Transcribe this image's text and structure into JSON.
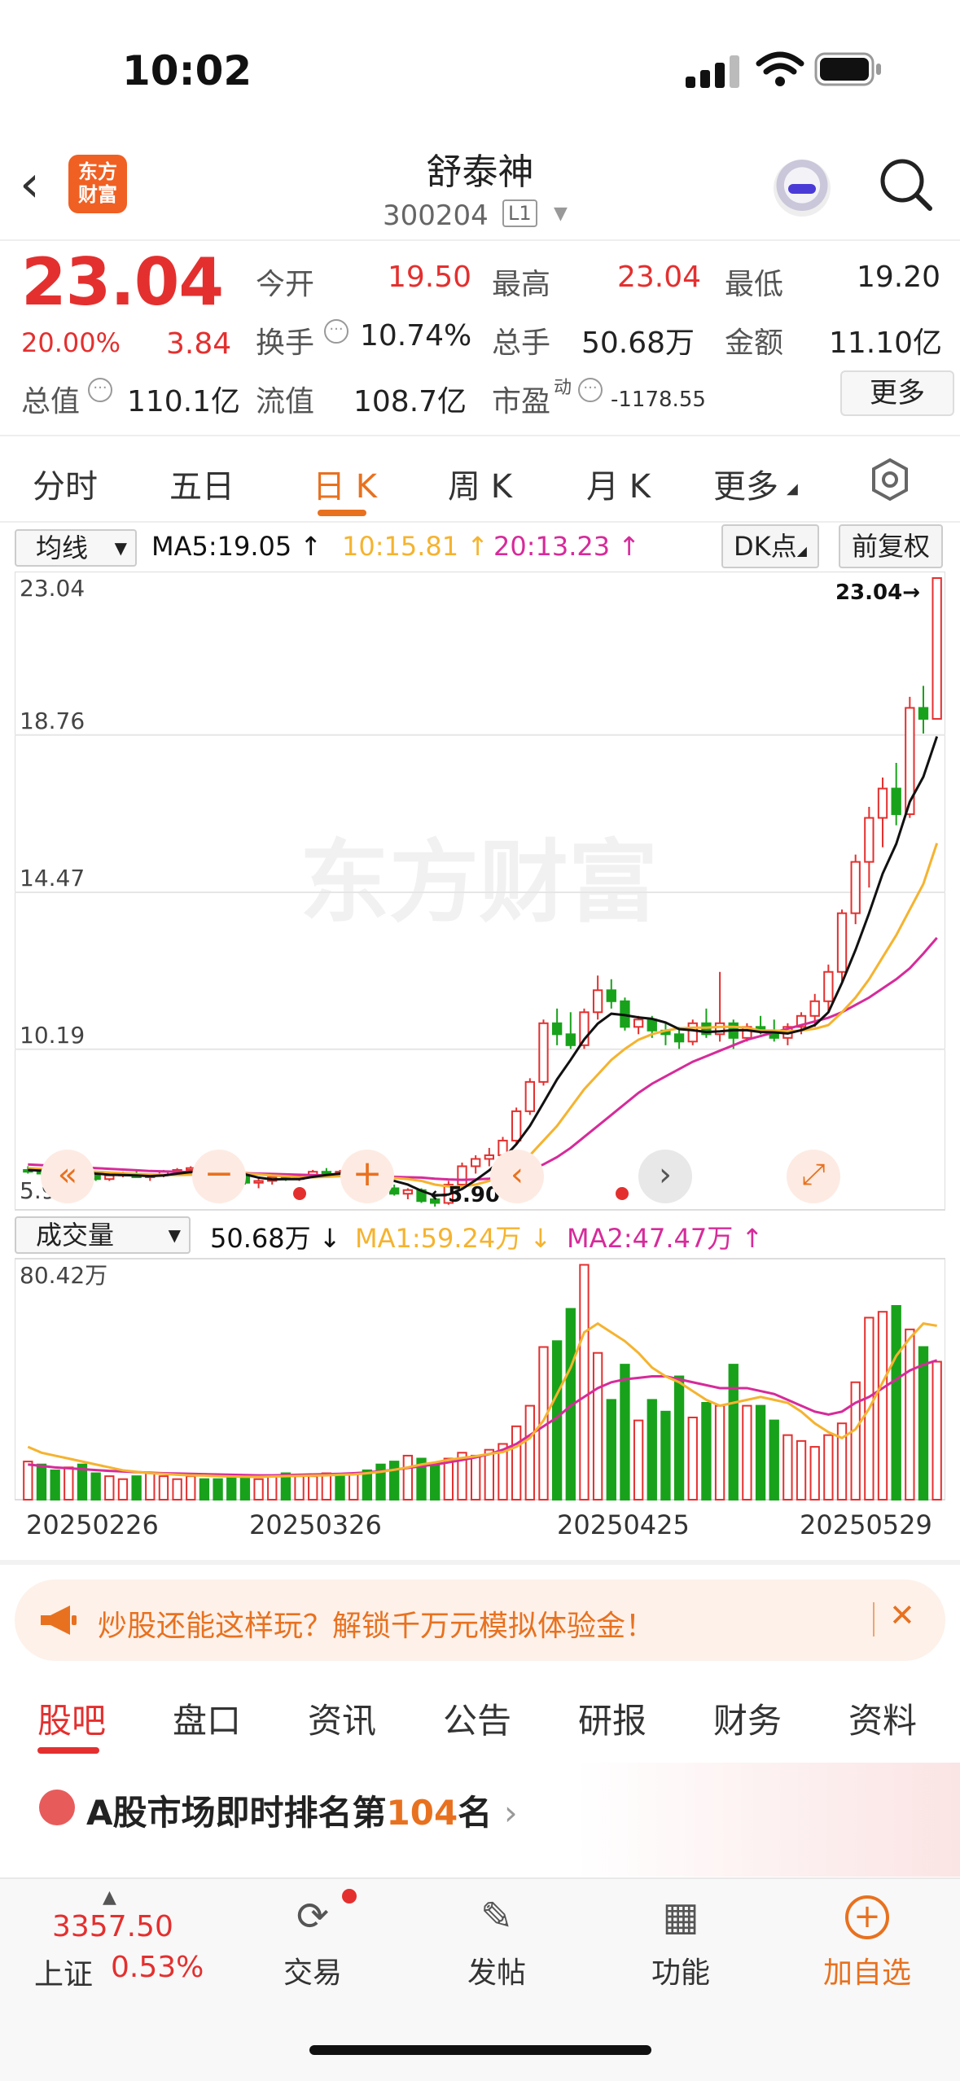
{
  "status_bar": {
    "time": "10:02"
  },
  "header": {
    "back_icon": "chevron-left-icon",
    "logo_line1": "东方",
    "logo_line2": "财富",
    "stock_name": "舒泰神",
    "stock_code": "300204",
    "level_badge": "L1",
    "search_icon": "search-icon"
  },
  "quote": {
    "price": "23.04",
    "change_pct": "20.00%",
    "change_amt": "3.84",
    "open_label": "今开",
    "open_value": "19.50",
    "high_label": "最高",
    "high_value": "23.04",
    "low_label": "最低",
    "low_value": "19.20",
    "turnover_label": "换手",
    "turnover_value": "10.74%",
    "volume_label": "总手",
    "volume_value": "50.68万",
    "amount_label": "金额",
    "amount_value": "11.10亿",
    "mktcap_label": "总值",
    "mktcap_value": "110.1亿",
    "float_label": "流值",
    "float_value": "108.7亿",
    "pe_label": "市盈",
    "pe_sup": "动",
    "pe_value": "-1178.55",
    "more_label": "更多"
  },
  "period_tabs": [
    "分时",
    "五日",
    "日 K",
    "周 K",
    "月 K",
    "更多"
  ],
  "active_period": "日 K",
  "kline_toolbar": {
    "indicator_select": "均线",
    "ma5": "MA5:19.05",
    "ma10": "10:15.81",
    "ma20": "20:13.23",
    "dk_label": "DK点",
    "adjust_label": "前复权"
  },
  "price_axis": [
    "23.04",
    "18.76",
    "14.47",
    "10.19",
    "5.90"
  ],
  "max_marker": "23.04→",
  "min_marker": "←5.90",
  "watermark": "东方财富",
  "volume_toolbar": {
    "indicator_select": "成交量",
    "volume": "50.68万",
    "ma1": "MA1:59.24万",
    "ma2": "MA2:47.47万"
  },
  "volume_axis_top": "80.42万",
  "date_axis": [
    "20250226",
    "20250326",
    "20250425",
    "20250529"
  ],
  "colors": {
    "up": "#e3302f",
    "down": "#18a21b",
    "ma5": "#111111",
    "ma10": "#f5b32f",
    "ma20": "#d62b9a",
    "accent": "#e8711f"
  },
  "chart_data": {
    "type": "candlestick",
    "ylim": [
      5.9,
      23.04
    ],
    "candles": [
      [
        6.9,
        7.0,
        6.8,
        6.85
      ],
      [
        6.85,
        6.95,
        6.75,
        6.8
      ],
      [
        6.8,
        6.9,
        6.7,
        6.9
      ],
      [
        6.9,
        6.95,
        6.8,
        6.85
      ],
      [
        6.85,
        6.9,
        6.75,
        6.8
      ],
      [
        6.8,
        6.85,
        6.6,
        6.65
      ],
      [
        6.65,
        6.8,
        6.6,
        6.75
      ],
      [
        6.75,
        6.85,
        6.7,
        6.8
      ],
      [
        6.8,
        6.9,
        6.7,
        6.7
      ],
      [
        6.7,
        6.8,
        6.6,
        6.75
      ],
      [
        6.75,
        6.9,
        6.7,
        6.85
      ],
      [
        6.85,
        6.95,
        6.8,
        6.9
      ],
      [
        6.9,
        7.0,
        6.8,
        6.95
      ],
      [
        6.95,
        7.0,
        6.85,
        6.9
      ],
      [
        6.9,
        6.95,
        6.8,
        6.85
      ],
      [
        6.85,
        6.9,
        6.7,
        6.75
      ],
      [
        6.75,
        6.8,
        6.5,
        6.55
      ],
      [
        6.55,
        6.7,
        6.4,
        6.6
      ],
      [
        6.6,
        6.75,
        6.5,
        6.7
      ],
      [
        6.7,
        6.8,
        6.6,
        6.65
      ],
      [
        6.65,
        6.8,
        6.6,
        6.75
      ],
      [
        6.75,
        6.9,
        6.7,
        6.85
      ],
      [
        6.85,
        6.95,
        6.7,
        6.8
      ],
      [
        6.8,
        6.9,
        6.7,
        6.85
      ],
      [
        6.85,
        7.0,
        6.8,
        6.95
      ],
      [
        6.95,
        7.0,
        6.6,
        6.65
      ],
      [
        6.65,
        6.7,
        6.3,
        6.35
      ],
      [
        6.4,
        6.5,
        6.2,
        6.25
      ],
      [
        6.25,
        6.4,
        6.1,
        6.35
      ],
      [
        6.35,
        6.4,
        6.0,
        6.05
      ],
      [
        6.1,
        6.2,
        5.9,
        6.0
      ],
      [
        6.0,
        6.6,
        5.95,
        6.5
      ],
      [
        6.5,
        7.1,
        6.4,
        7.0
      ],
      [
        7.0,
        7.3,
        6.8,
        7.2
      ],
      [
        7.2,
        7.5,
        7.0,
        7.3
      ],
      [
        7.3,
        7.8,
        7.2,
        7.7
      ],
      [
        7.7,
        8.6,
        7.6,
        8.5
      ],
      [
        8.5,
        9.4,
        8.4,
        9.3
      ],
      [
        9.3,
        11.0,
        9.2,
        10.9
      ],
      [
        10.9,
        11.3,
        10.3,
        10.6
      ],
      [
        10.6,
        11.2,
        10.2,
        10.3
      ],
      [
        10.3,
        11.3,
        10.2,
        11.2
      ],
      [
        11.2,
        12.2,
        11.0,
        11.8
      ],
      [
        11.8,
        12.1,
        11.3,
        11.5
      ],
      [
        11.5,
        11.6,
        10.7,
        10.8
      ],
      [
        10.8,
        11.1,
        10.6,
        11.0
      ],
      [
        11.0,
        11.1,
        10.5,
        10.7
      ],
      [
        10.7,
        10.9,
        10.3,
        10.6
      ],
      [
        10.6,
        10.8,
        10.2,
        10.4
      ],
      [
        10.4,
        11.0,
        10.3,
        10.9
      ],
      [
        10.9,
        11.3,
        10.5,
        10.6
      ],
      [
        10.6,
        12.3,
        10.4,
        10.9
      ],
      [
        10.9,
        11.0,
        10.2,
        10.5
      ],
      [
        10.5,
        10.9,
        10.4,
        10.8
      ],
      [
        10.8,
        11.1,
        10.6,
        10.7
      ],
      [
        10.7,
        11.0,
        10.4,
        10.5
      ],
      [
        10.5,
        10.9,
        10.3,
        10.8
      ],
      [
        10.8,
        11.2,
        10.6,
        11.1
      ],
      [
        11.1,
        11.7,
        10.8,
        11.5
      ],
      [
        11.5,
        12.5,
        11.2,
        12.3
      ],
      [
        12.3,
        14.0,
        12.0,
        13.9
      ],
      [
        13.9,
        15.5,
        13.6,
        15.3
      ],
      [
        15.3,
        16.8,
        14.6,
        16.5
      ],
      [
        16.5,
        17.6,
        15.7,
        17.3
      ],
      [
        17.3,
        18.0,
        16.3,
        16.6
      ],
      [
        16.6,
        19.8,
        16.5,
        19.5
      ],
      [
        19.5,
        20.1,
        18.8,
        19.2
      ],
      [
        19.2,
        23.04,
        19.2,
        23.04
      ]
    ],
    "ma5": [
      6.9,
      6.88,
      6.86,
      6.85,
      6.84,
      6.8,
      6.77,
      6.76,
      6.75,
      6.73,
      6.75,
      6.8,
      6.84,
      6.87,
      6.89,
      6.86,
      6.78,
      6.69,
      6.64,
      6.65,
      6.65,
      6.71,
      6.76,
      6.8,
      6.84,
      6.82,
      6.72,
      6.6,
      6.5,
      6.33,
      6.2,
      6.23,
      6.38,
      6.62,
      6.89,
      7.2,
      7.6,
      8.1,
      8.73,
      9.37,
      9.9,
      10.46,
      10.89,
      11.16,
      11.12,
      11.06,
      11.02,
      10.92,
      10.74,
      10.71,
      10.66,
      10.68,
      10.71,
      10.71,
      10.66,
      10.65,
      10.62,
      10.71,
      10.85,
      11.2,
      12.0,
      12.9,
      13.9,
      14.98,
      15.79,
      16.94,
      17.62,
      18.72
    ],
    "ma10": [
      6.95,
      6.93,
      6.91,
      6.89,
      6.87,
      6.85,
      6.83,
      6.81,
      6.79,
      6.78,
      6.77,
      6.76,
      6.77,
      6.79,
      6.8,
      6.81,
      6.8,
      6.78,
      6.75,
      6.73,
      6.7,
      6.7,
      6.71,
      6.73,
      6.75,
      6.74,
      6.71,
      6.68,
      6.65,
      6.6,
      6.5,
      6.45,
      6.45,
      6.5,
      6.6,
      6.75,
      7.0,
      7.3,
      7.7,
      8.1,
      8.6,
      9.1,
      9.5,
      9.9,
      10.2,
      10.45,
      10.6,
      10.7,
      10.76,
      10.78,
      10.78,
      10.8,
      10.8,
      10.78,
      10.7,
      10.7,
      10.68,
      10.7,
      10.75,
      10.85,
      11.2,
      11.6,
      12.1,
      12.7,
      13.3,
      14.0,
      14.7,
      15.81
    ],
    "ma20": [
      7.05,
      7.03,
      7.01,
      6.99,
      6.97,
      6.95,
      6.93,
      6.91,
      6.89,
      6.87,
      6.86,
      6.85,
      6.84,
      6.83,
      6.82,
      6.82,
      6.81,
      6.8,
      6.79,
      6.78,
      6.77,
      6.76,
      6.75,
      6.74,
      6.73,
      6.72,
      6.72,
      6.71,
      6.7,
      6.69,
      6.66,
      6.64,
      6.63,
      6.64,
      6.66,
      6.7,
      6.78,
      6.9,
      7.05,
      7.25,
      7.5,
      7.8,
      8.1,
      8.4,
      8.7,
      9.0,
      9.25,
      9.45,
      9.65,
      9.85,
      10.0,
      10.15,
      10.3,
      10.45,
      10.55,
      10.65,
      10.75,
      10.85,
      10.95,
      11.05,
      11.2,
      11.4,
      11.6,
      11.85,
      12.1,
      12.4,
      12.8,
      13.23
    ],
    "volume_ylim": [
      0,
      80.42
    ],
    "volumes": [
      13,
      12,
      10,
      11,
      12,
      9,
      8,
      7,
      8,
      9,
      8,
      7,
      8,
      7,
      7,
      8,
      8,
      7,
      8,
      9,
      8,
      8,
      9,
      8,
      9,
      10,
      12,
      13,
      15,
      14,
      12,
      14,
      16,
      15,
      17,
      19,
      25,
      32,
      52,
      54,
      65,
      80,
      50,
      34,
      46,
      27,
      34,
      30,
      42,
      28,
      33,
      32,
      46,
      32,
      32,
      27,
      22,
      20,
      18,
      22,
      26,
      40,
      62,
      64,
      66,
      58,
      52,
      47
    ],
    "volume_up": [
      true,
      false,
      false,
      true,
      false,
      false,
      true,
      true,
      false,
      true,
      true,
      true,
      true,
      false,
      false,
      false,
      false,
      true,
      true,
      false,
      true,
      true,
      true,
      false,
      true,
      false,
      false,
      false,
      true,
      false,
      false,
      true,
      true,
      true,
      true,
      true,
      true,
      true,
      true,
      false,
      false,
      true,
      true,
      false,
      false,
      true,
      false,
      false,
      false,
      true,
      false,
      true,
      false,
      true,
      false,
      false,
      true,
      true,
      true,
      true,
      true,
      true,
      true,
      true,
      false,
      true,
      false,
      true
    ],
    "vol_ma1": [
      18,
      16,
      15,
      14,
      13,
      12,
      11,
      10,
      9.5,
      9,
      8.8,
      8.5,
      8.3,
      8.2,
      8.0,
      7.9,
      7.8,
      7.8,
      7.9,
      8.0,
      8.1,
      8.2,
      8.3,
      8.5,
      8.6,
      9.0,
      9.5,
      10.2,
      11,
      12,
      12.7,
      13.6,
      14.2,
      14.8,
      15.6,
      16.2,
      18,
      21,
      27,
      36,
      45,
      57,
      60,
      57,
      54,
      50,
      45,
      42,
      40,
      37,
      34,
      32,
      33,
      34,
      35,
      34,
      33,
      30,
      26,
      23,
      21,
      24,
      31,
      40,
      49,
      55,
      60,
      59.24
    ],
    "vol_ma2": [
      12,
      11.5,
      11,
      10.7,
      10.4,
      10.1,
      9.8,
      9.6,
      9.4,
      9.2,
      9.0,
      8.9,
      8.8,
      8.7,
      8.6,
      8.5,
      8.4,
      8.3,
      8.3,
      8.4,
      8.5,
      8.6,
      8.7,
      8.8,
      9.0,
      9.3,
      9.7,
      10.2,
      10.8,
      11.4,
      12.0,
      12.7,
      13.5,
      14.4,
      15.5,
      17.0,
      19,
      22,
      25,
      28,
      32,
      35,
      38,
      40,
      41,
      41.5,
      42,
      42,
      41,
      40,
      39,
      38,
      38,
      38,
      37,
      36,
      34,
      32,
      30,
      29,
      30,
      33,
      35,
      38,
      41,
      44,
      46,
      47.47
    ]
  },
  "promo": {
    "text": "炒股还能这样玩？解锁千万元模拟体验金！",
    "icon": "megaphone-icon"
  },
  "bottom_tabs": [
    "股吧",
    "盘口",
    "资讯",
    "公告",
    "研报",
    "财务",
    "资料"
  ],
  "active_bottom_tab": "股吧",
  "ranking": {
    "prefix": "A股市场即时排名第",
    "rank": "104",
    "suffix": "名"
  },
  "bottom_nav": {
    "index_value": "3357.50",
    "index_name": "上证",
    "index_change": "0.53%",
    "items": [
      {
        "label": "交易",
        "icon": "yen-cycle-icon"
      },
      {
        "label": "发帖",
        "icon": "edit-icon"
      },
      {
        "label": "功能",
        "icon": "grid-icon"
      },
      {
        "label": "加自选",
        "icon": "add-circle-icon"
      }
    ]
  }
}
